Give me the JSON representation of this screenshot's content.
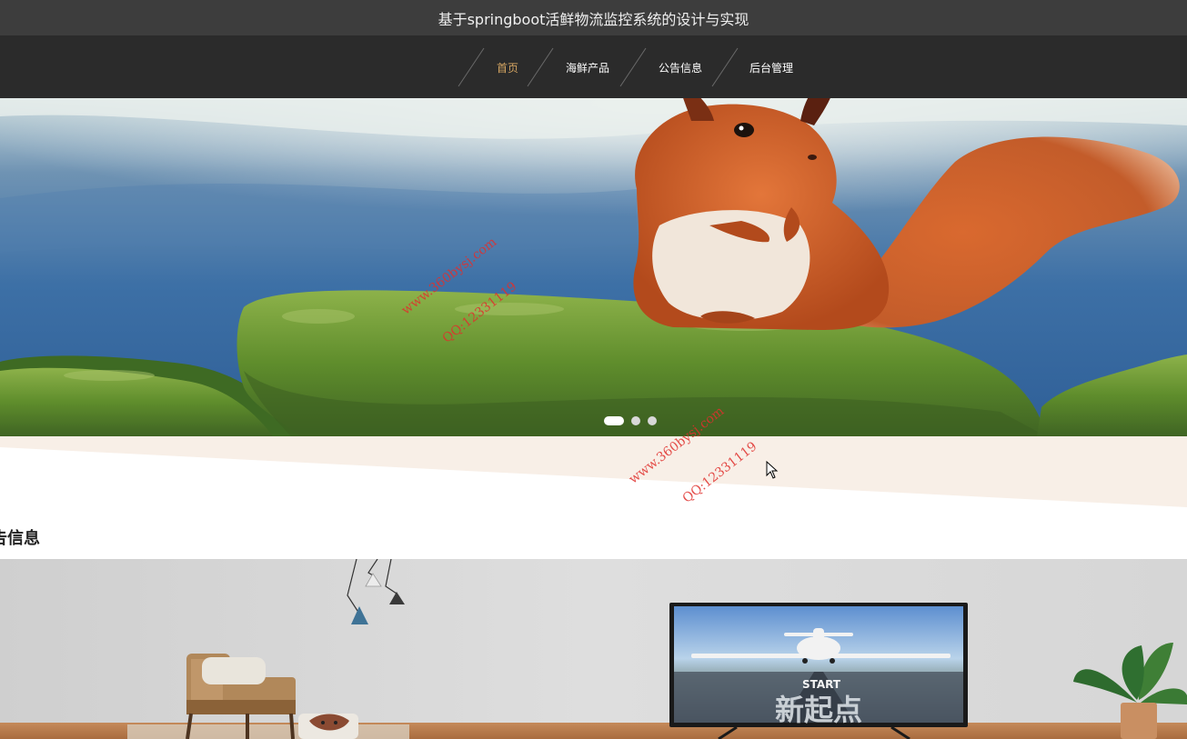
{
  "header": {
    "title": "基于springboot活鲜物流监控系统的设计与实现"
  },
  "nav": {
    "items": [
      {
        "label": "首页",
        "active": true
      },
      {
        "label": "海鲜产品",
        "active": false
      },
      {
        "label": "公告信息",
        "active": false
      },
      {
        "label": "后台管理",
        "active": false
      }
    ]
  },
  "carousel": {
    "slide_count": 3,
    "active_index": 0
  },
  "section": {
    "title": "告信息"
  },
  "tv": {
    "caption": "START",
    "headline": "新起点"
  },
  "watermarks": [
    {
      "text": "www.360bysj.com"
    },
    {
      "text": "QQ:12331119"
    },
    {
      "text": "www.360bysj.com"
    },
    {
      "text": "QQ:12331119"
    }
  ],
  "colors": {
    "title_bar": "#3d3d3d",
    "nav_bar": "#2b2b2b",
    "nav_active": "#d4a562",
    "divider": "#f8efe7",
    "watermark": "#e0302d"
  }
}
